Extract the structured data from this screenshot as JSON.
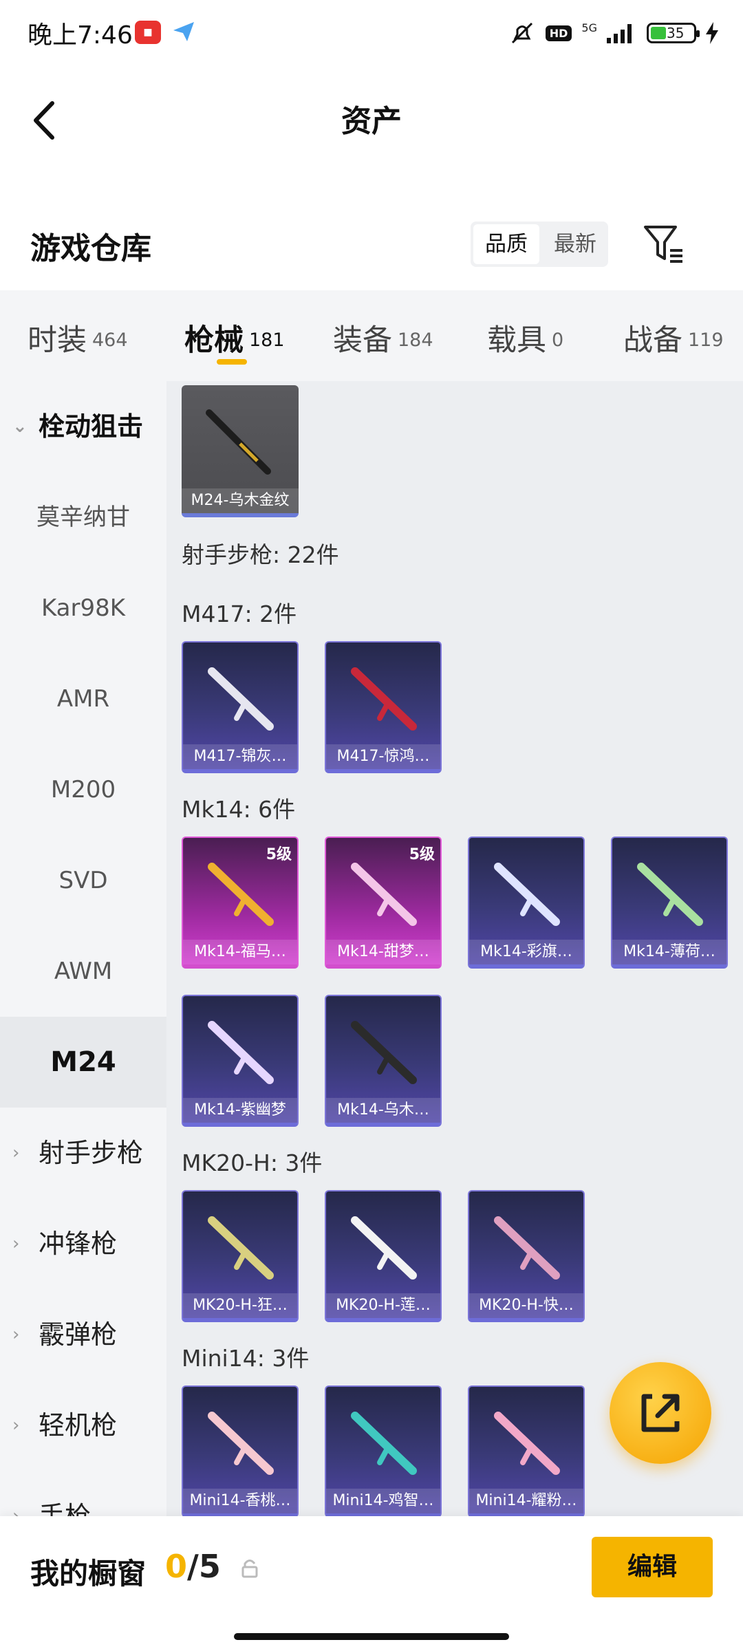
{
  "status_bar": {
    "time": "晚上7:46",
    "hd": "HD",
    "network": "5G",
    "battery": "35"
  },
  "header": {
    "title": "资产"
  },
  "warehouse": {
    "title": "游戏仓库",
    "sort_options": [
      "品质",
      "最新"
    ],
    "active_sort": "品质"
  },
  "tabs": [
    {
      "label": "时装",
      "count": "464"
    },
    {
      "label": "枪械",
      "count": "181",
      "active": true
    },
    {
      "label": "装备",
      "count": "184"
    },
    {
      "label": "载具",
      "count": "0"
    },
    {
      "label": "战备",
      "count": "119"
    }
  ],
  "sidebar": {
    "open_group": "栓动狙击",
    "sub_items": [
      "莫辛纳甘",
      "Kar98K",
      "AMR",
      "M200",
      "SVD",
      "AWM",
      "M24"
    ],
    "selected": "M24",
    "groups": [
      "射手步枪",
      "冲锋枪",
      "霰弹枪",
      "轻机枪",
      "手枪"
    ]
  },
  "content": {
    "top_card": {
      "caption": "M24-乌木金纹"
    },
    "category_summary": "射手步枪: 22件",
    "groups": [
      {
        "label": "M417: 2件",
        "items": [
          {
            "caption": "M417-锦灰…",
            "style": "blue"
          },
          {
            "caption": "M417-惊鸿…",
            "style": "blue"
          }
        ]
      },
      {
        "label": "Mk14: 6件",
        "items": [
          {
            "caption": "Mk14-福马…",
            "style": "pink",
            "level": "5级"
          },
          {
            "caption": "Mk14-甜梦…",
            "style": "pink",
            "level": "5级"
          },
          {
            "caption": "Mk14-彩旗…",
            "style": "blue"
          },
          {
            "caption": "Mk14-薄荷…",
            "style": "blue"
          },
          {
            "caption": "Mk14-紫幽梦",
            "style": "blue"
          },
          {
            "caption": "Mk14-乌木…",
            "style": "blue"
          }
        ]
      },
      {
        "label": "MK20-H: 3件",
        "items": [
          {
            "caption": "MK20-H-狂…",
            "style": "blue"
          },
          {
            "caption": "MK20-H-莲…",
            "style": "blue"
          },
          {
            "caption": "MK20-H-快…",
            "style": "blue"
          }
        ]
      },
      {
        "label": "Mini14: 3件",
        "items": [
          {
            "caption": "Mini14-香桃…",
            "style": "blue"
          },
          {
            "caption": "Mini14-鸡智…",
            "style": "blue"
          },
          {
            "caption": "Mini14-耀粉…",
            "style": "blue"
          }
        ]
      }
    ]
  },
  "bottom_bar": {
    "label": "我的橱窗",
    "current": "0",
    "total": "5",
    "edit_label": "编辑"
  },
  "colors": {
    "accent": "#f5b400",
    "blue_card": "#3a3a78",
    "pink_card": "#9c2a9e"
  }
}
